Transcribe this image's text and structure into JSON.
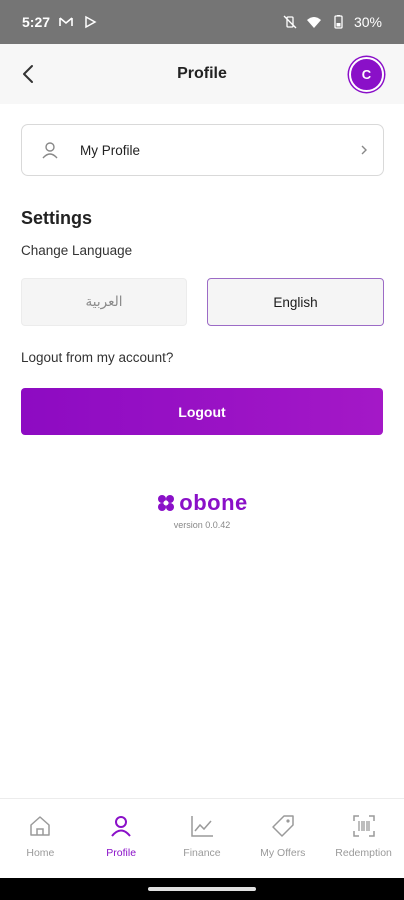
{
  "status_bar": {
    "time": "5:27",
    "battery": "30%",
    "left_icons": [
      "gmail-icon",
      "play-icon"
    ],
    "right_icons": [
      "vibrate-off-icon",
      "wifi-icon",
      "battery-icon"
    ]
  },
  "header": {
    "title": "Profile",
    "avatar_initial": "C"
  },
  "profile_card": {
    "label": "My Profile"
  },
  "settings": {
    "title": "Settings",
    "change_language_label": "Change Language",
    "languages": [
      {
        "label": "العربية",
        "selected": false
      },
      {
        "label": "English",
        "selected": true
      }
    ]
  },
  "logout": {
    "question": "Logout from my account?",
    "button_label": "Logout"
  },
  "brand": {
    "name": "obone",
    "version": "version 0.0.42"
  },
  "bottom_nav": {
    "items": [
      {
        "label": "Home",
        "icon": "home-icon",
        "active": false
      },
      {
        "label": "Profile",
        "icon": "user-icon",
        "active": true
      },
      {
        "label": "Finance",
        "icon": "chart-icon",
        "active": false
      },
      {
        "label": "My Offers",
        "icon": "tag-icon",
        "active": false
      },
      {
        "label": "Redemption",
        "icon": "barcode-icon",
        "active": false
      }
    ]
  },
  "colors": {
    "accent": "#8a10c8",
    "status_bar": "#757575",
    "header_bg": "#f7f7f7"
  }
}
